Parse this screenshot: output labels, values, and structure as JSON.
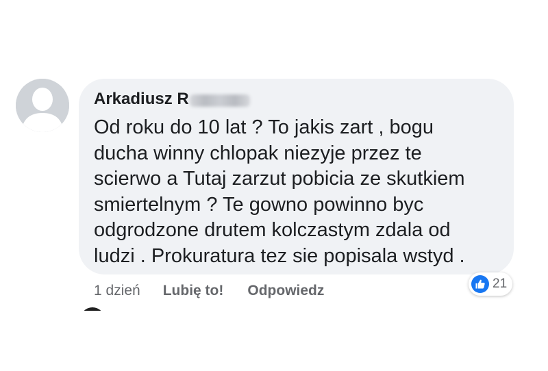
{
  "comment": {
    "author_visible": "Arkadiusz R",
    "text_lines": [
      "Od roku do 10 lat ? To jakis zart , bogu",
      "ducha winny chlopak niezyje przez te",
      "scierwo a Tutaj zarzut pobicia ze skutkiem",
      "smiertelnym ? Te gowno powinno byc",
      "odgrodzone drutem kolczastym zdala od",
      "ludzi . Prokuratura tez sie popisala wstyd ."
    ],
    "timestamp": "1 dzień",
    "like_label": "Lubię to!",
    "reply_label": "Odpowiedz",
    "reaction_count": "21",
    "reaction_icon": "thumbs-up-icon"
  },
  "colors": {
    "bubble": "#f0f2f5",
    "text": "#1c1e21",
    "meta": "#65676b",
    "like_blue": "#1877f2"
  }
}
